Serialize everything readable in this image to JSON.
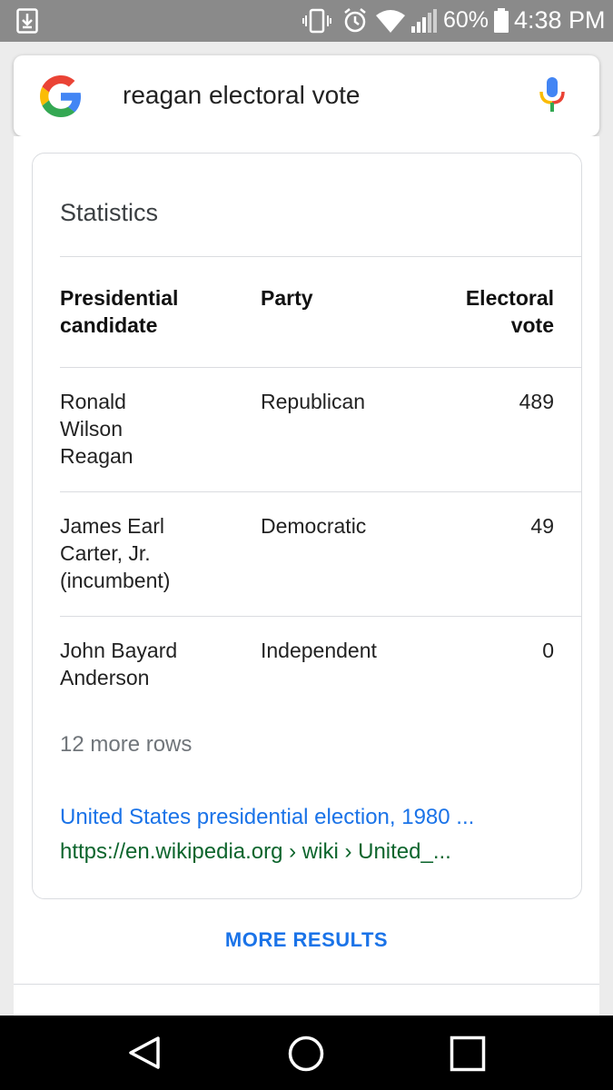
{
  "status_bar": {
    "battery_percent": "60%",
    "time": "4:38 PM",
    "icons": [
      "download-notification-icon",
      "vibrate-icon",
      "alarm-icon",
      "wifi-icon",
      "signal-icon",
      "battery-icon"
    ]
  },
  "search": {
    "query": "reagan electoral vote",
    "icons": [
      "google-logo",
      "mic-icon"
    ]
  },
  "card": {
    "title": "Statistics",
    "headers": {
      "candidate": "Presidential candidate",
      "party": "Party",
      "vote": "Electoral vote"
    },
    "rows": [
      {
        "candidate": "Ronald Wilson Reagan",
        "party": "Republican",
        "vote": "489"
      },
      {
        "candidate": "James Earl Carter, Jr. (incumbent)",
        "party": "Democratic",
        "vote": "49"
      },
      {
        "candidate": "John Bayard Anderson",
        "party": "Independent",
        "vote": "0"
      }
    ],
    "more_rows": "12 more rows",
    "link_title": "United States presidential election, 1980 ...",
    "link_url": "https://en.wikipedia.org › wiki › United_..."
  },
  "more_results": "MORE RESULTS",
  "colors": {
    "link": "#1a73e8",
    "url": "#0d652d",
    "status_bar": "#8a8a8a",
    "google_blue": "#4285F4",
    "google_red": "#EA4335",
    "google_yellow": "#FBBC05",
    "google_green": "#34A853"
  },
  "nav_bar": {
    "icons": [
      "back-icon",
      "home-icon",
      "recent-apps-icon"
    ]
  }
}
